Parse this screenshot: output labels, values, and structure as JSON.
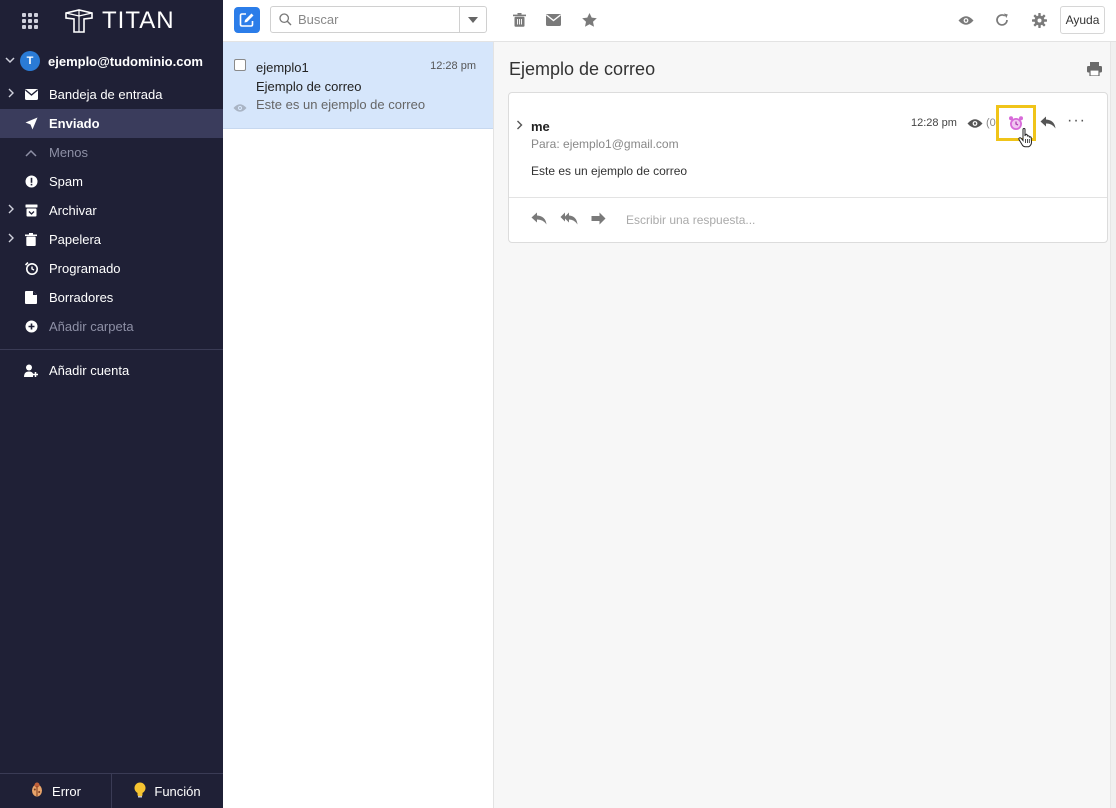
{
  "brand": {
    "name": "TITAN"
  },
  "account": {
    "email": "ejemplo@tudominio.com",
    "initial": "T"
  },
  "sidebar": {
    "items": [
      {
        "label": "Bandeja de entrada",
        "icon": "inbox-icon",
        "has_caret": true
      },
      {
        "label": "Enviado",
        "icon": "send-icon",
        "active": true
      },
      {
        "label": "Menos",
        "icon": "chevron-up-icon",
        "muted": true
      },
      {
        "label": "Spam",
        "icon": "spam-icon"
      },
      {
        "label": "Archivar",
        "icon": "archive-icon",
        "has_caret": true
      },
      {
        "label": "Papelera",
        "icon": "trash-icon",
        "has_caret": true
      },
      {
        "label": "Programado",
        "icon": "scheduled-icon"
      },
      {
        "label": "Borradores",
        "icon": "drafts-icon"
      },
      {
        "label": "Añadir carpeta",
        "icon": "add-folder-icon",
        "muted": true
      }
    ],
    "add_account": "Añadir cuenta",
    "footer": {
      "error_label": "Error",
      "feature_label": "Función"
    }
  },
  "toolbar": {
    "search_placeholder": "Buscar",
    "help_label": "Ayuda"
  },
  "message_list": {
    "items": [
      {
        "sender": "ejemplo1",
        "time": "12:28 pm",
        "subject": "Ejemplo de correo",
        "preview": "Este es un ejemplo de correo"
      }
    ]
  },
  "reader": {
    "title": "Ejemplo de correo",
    "message": {
      "from": "me",
      "to": "Para: ejemplo1@gmail.com",
      "time": "12:28 pm",
      "views": "(0",
      "body": "Este es un ejemplo de correo"
    },
    "reply_placeholder": "Escribir una respuesta..."
  },
  "colors": {
    "sidebar_bg": "#1f2036",
    "accent": "#2b7de9",
    "selected_row": "#d6e6fb",
    "highlight": "#f0c419",
    "alarm": "#d86ad9"
  }
}
